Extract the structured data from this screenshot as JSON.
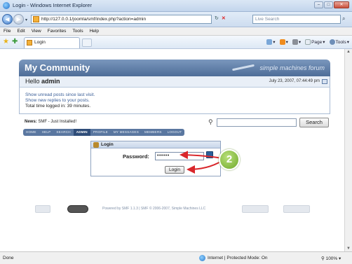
{
  "window": {
    "title": "Login - Windows Internet Explorer",
    "min": "‒",
    "max": "□",
    "close": "✕"
  },
  "address": {
    "url": "http://127.0.0.1/joomla/smf/index.php?action=admin",
    "search_placeholder": "Live Search",
    "refresh": "↻",
    "stop": "✕",
    "search_go": "⌕"
  },
  "menu": [
    "File",
    "Edit",
    "View",
    "Favorites",
    "Tools",
    "Help"
  ],
  "tab": {
    "label": "Login"
  },
  "commands": [
    "",
    "",
    "Page",
    "Tools"
  ],
  "forum": {
    "title": "My Community",
    "brand": "simple machines forum",
    "hello_prefix": "Hello ",
    "username": "admin",
    "datetime": "July 23, 2007, 07:44:49 pm",
    "unread_link": "Show unread posts since last visit.",
    "replies_link": "Show new replies to your posts.",
    "time_logged": "Total time logged in: 39 minutes.",
    "news_label": "News:",
    "news_text": " SMF - Just Installed!",
    "search_button": "Search",
    "tabs": [
      "HOME",
      "HELP",
      "SEARCH",
      "ADMIN",
      "PROFILE",
      "MY MESSAGES",
      "MEMBERS",
      "LOGOUT"
    ],
    "active_tab": "ADMIN"
  },
  "login": {
    "header": "Login",
    "password_label": "Password:",
    "password_value": "••••••",
    "button": "Login"
  },
  "callout": {
    "number": "2"
  },
  "footer": {
    "text": "Powered by SMF 1.1.3 | SMF © 2006-2007, Simple Machines LLC"
  },
  "status": {
    "left": "Done",
    "zone": "Internet | Protected Mode: On",
    "zoom": "100%"
  },
  "colors": {
    "header_blue": "#5b7aa5",
    "arrow_red": "#d9262b",
    "callout_green": "#7cb342"
  }
}
